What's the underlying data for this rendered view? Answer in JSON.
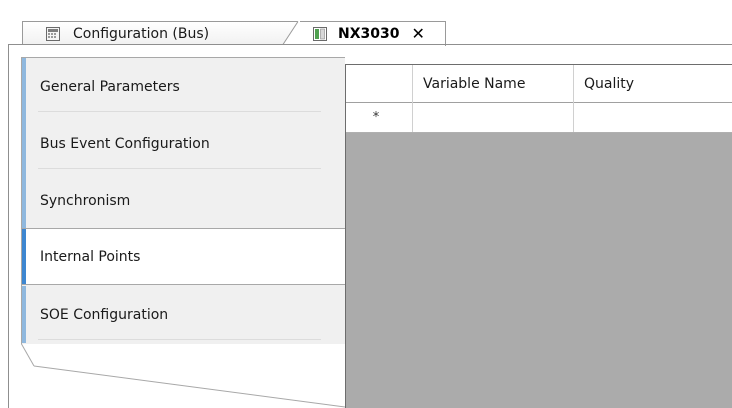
{
  "tabs": [
    {
      "label": "Configuration (Bus)",
      "icon": "bus-grid-icon",
      "active": false
    },
    {
      "label": "NX3030",
      "icon": "device-module-icon",
      "active": true,
      "close_glyph": "✕"
    }
  ],
  "nav": {
    "items": [
      {
        "label": "General Parameters",
        "selected": false
      },
      {
        "label": "Bus Event Configuration",
        "selected": false
      },
      {
        "label": "Synchronism",
        "selected": false
      },
      {
        "label": "Internal Points",
        "selected": true
      },
      {
        "label": "SOE Configuration",
        "selected": false
      }
    ]
  },
  "grid": {
    "columns": [
      "Variable Name",
      "Quality"
    ],
    "new_row_marker": "*",
    "rows": [
      {
        "variable_name": "",
        "quality": ""
      }
    ]
  },
  "colors": {
    "accent_selected": "#3d86d0",
    "accent_normal": "#8fb8de",
    "grid_background": "#ababab"
  }
}
